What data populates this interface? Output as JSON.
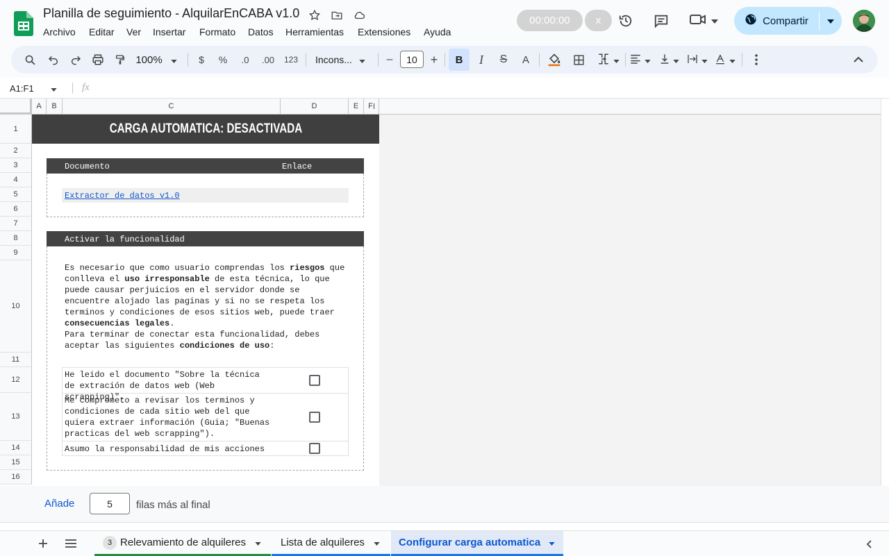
{
  "app": {
    "title": "Planilla de seguimiento - AlquilarEnCABA v1.0",
    "menu": [
      "Archivo",
      "Editar",
      "Ver",
      "Insertar",
      "Formato",
      "Datos",
      "Herramientas",
      "Extensiones",
      "Ayuda"
    ],
    "timer": "00:00:00",
    "close_x": "x",
    "share_label": "Compartir",
    "accent_blue": "#0b57d0",
    "share_bg": "#c2e7ff"
  },
  "toolbar": {
    "zoom": "100%",
    "currency": "$",
    "percent": "%",
    "dec_less": ".0",
    "dec_more": ".00",
    "format_123": "123",
    "font": "Incons...",
    "font_size": "10",
    "minus": "–",
    "plus": "+"
  },
  "formula": {
    "name_box": "A1:F1",
    "fx": "fx"
  },
  "grid": {
    "columns": [
      "A",
      "B",
      "C",
      "D",
      "E",
      "F"
    ],
    "rows": [
      "1",
      "2",
      "3",
      "4",
      "5",
      "6",
      "7",
      "8",
      "9",
      "10",
      "11",
      "12",
      "13",
      "14",
      "15",
      "16"
    ],
    "banner": "CARGA AUTOMATICA: DESACTIVADA",
    "doc_header": {
      "documento": "Documento",
      "enlace": "Enlace"
    },
    "doc_link": "Extractor de datos v1.0",
    "activar_header": "Activar la funcionalidad",
    "para1": [
      {
        "t": "Es necesario que como usuario comprendas los ",
        "b": false
      },
      {
        "t": "riesgos",
        "b": true
      },
      {
        "t": " que conlleva el ",
        "b": false
      },
      {
        "t": "uso irresponsable",
        "b": true
      },
      {
        "t": " de esta técnica, lo que puede causar perjuicios en el servidor donde se encuentre alojado las paginas y si no se respeta los terminos y condiciones de esos sitios web, puede traer ",
        "b": false
      },
      {
        "t": "consecuencias legales",
        "b": true
      },
      {
        "t": ".",
        "b": false
      }
    ],
    "para2": [
      {
        "t": "Para terminar de conectar esta funcionalidad, debes aceptar las siguientes ",
        "b": false
      },
      {
        "t": "condiciones de uso",
        "b": true
      },
      {
        "t": ":",
        "b": false
      }
    ],
    "conditions": [
      {
        "text": "He leido el documento \"Sobre la técnica de extración de datos web (Web scrapping)\".",
        "checked": false
      },
      {
        "text": "Me comprometo a revisar los terminos y condiciones de cada sitio web del que quiera extraer información (Guia; \"Buenas practicas del web scrapping\").",
        "checked": false
      },
      {
        "text": "Asumo la responsabilidad de mis acciones",
        "checked": false
      }
    ]
  },
  "add_rows": {
    "button": "Añade",
    "count": "5",
    "suffix": "filas más al final"
  },
  "sheets": {
    "badge": "3",
    "tabs": [
      {
        "label": "Relevamiento de alquileres",
        "color": "#1e8e3e",
        "active": false
      },
      {
        "label": "Lista de alquileres",
        "color": "#1a73e8",
        "active": false
      },
      {
        "label": "Configurar carga automatica",
        "color": "#1a73e8",
        "active": true
      }
    ]
  }
}
